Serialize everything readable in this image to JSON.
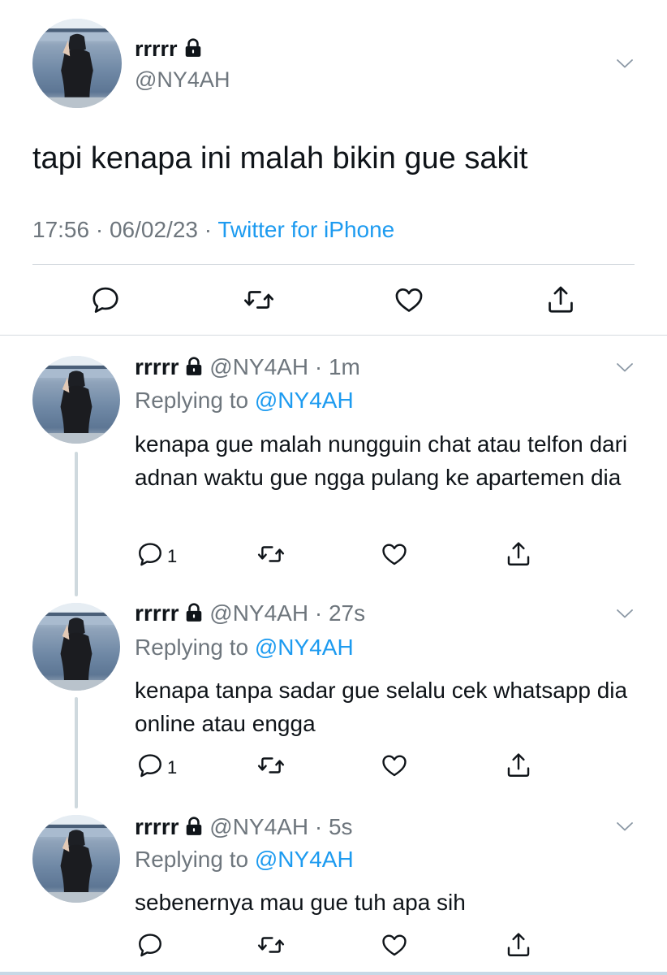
{
  "main_tweet": {
    "display_name": "rrrrr",
    "handle": "@NY4AH",
    "text": "tapi kenapa ini malah bikin gue sakit",
    "time": "17:56",
    "date": "06/02/23",
    "source": "Twitter for iPhone",
    "icons": [
      "reply-icon",
      "retweet-icon",
      "like-icon",
      "share-icon",
      "chevron-down-icon",
      "lock-icon"
    ]
  },
  "replies": [
    {
      "display_name": "rrrrr",
      "handle": "@NY4AH",
      "age": "1m",
      "replying_label": "Replying to",
      "replying_to": "@NY4AH",
      "text": "kenapa gue malah nungguin chat atau telfon dari adnan waktu gue ngga pulang ke apartemen dia",
      "reply_count": "1"
    },
    {
      "display_name": "rrrrr",
      "handle": "@NY4AH",
      "age": "27s",
      "replying_label": "Replying to",
      "replying_to": "@NY4AH",
      "text": "kenapa tanpa sadar gue selalu cek whatsapp dia online atau engga",
      "reply_count": "1"
    },
    {
      "display_name": "rrrrr",
      "handle": "@NY4AH",
      "age": "5s",
      "replying_label": "Replying to",
      "replying_to": "@NY4AH",
      "text": "sebenernya mau gue tuh apa sih",
      "reply_count": ""
    }
  ],
  "colors": {
    "text": "#0f1419",
    "muted": "#6e767d",
    "link": "#1d9bf0",
    "divider": "#d5dbe0",
    "thread_line": "#cfd9de"
  }
}
